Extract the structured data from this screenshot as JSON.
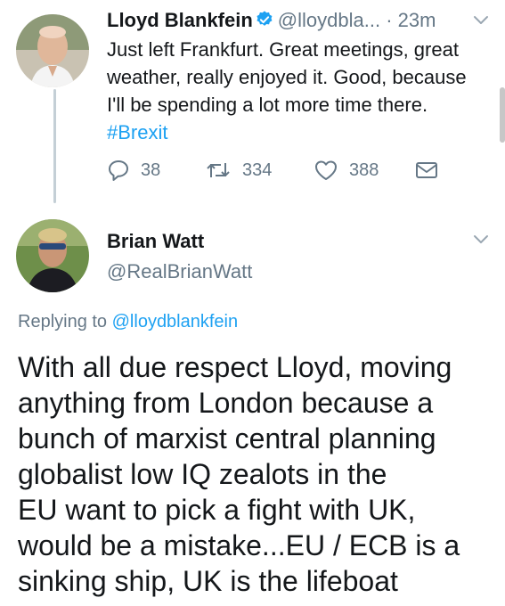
{
  "tweet1": {
    "author_name": "Lloyd Blankfein",
    "handle": "@lloydbla...",
    "time": "· 23m",
    "text_lines": [
      "Just left Frankfurt. Great meetings, great",
      "weather, really enjoyed it. Good, because",
      "I'll be spending a lot more time there."
    ],
    "hashtag": "#Brexit",
    "reply_count": "38",
    "retweet_count": "334",
    "like_count": "388"
  },
  "tweet2": {
    "author_name": "Brian Watt",
    "handle": "@RealBrianWatt",
    "replying_prefix": "Replying to",
    "replying_handle": "@lloydblankfein",
    "text_lines": [
      "With all due respect Lloyd, moving",
      "anything from London because a",
      "bunch of marxist central planning",
      "globalist low IQ zealots in the",
      "EU want to pick a fight with UK,",
      "would be a mistake...EU / ECB is a",
      "sinking ship, UK is the lifeboat"
    ]
  },
  "colors": {
    "accent": "#1da1f2",
    "secondary_text": "#657786",
    "primary_text": "#14171a",
    "thread_line": "#c4cfd6"
  },
  "icons": {
    "verified": "verified-badge-icon",
    "chevron": "chevron-down-icon",
    "reply": "reply-icon",
    "retweet": "retweet-icon",
    "like": "heart-icon",
    "dm": "envelope-icon"
  }
}
